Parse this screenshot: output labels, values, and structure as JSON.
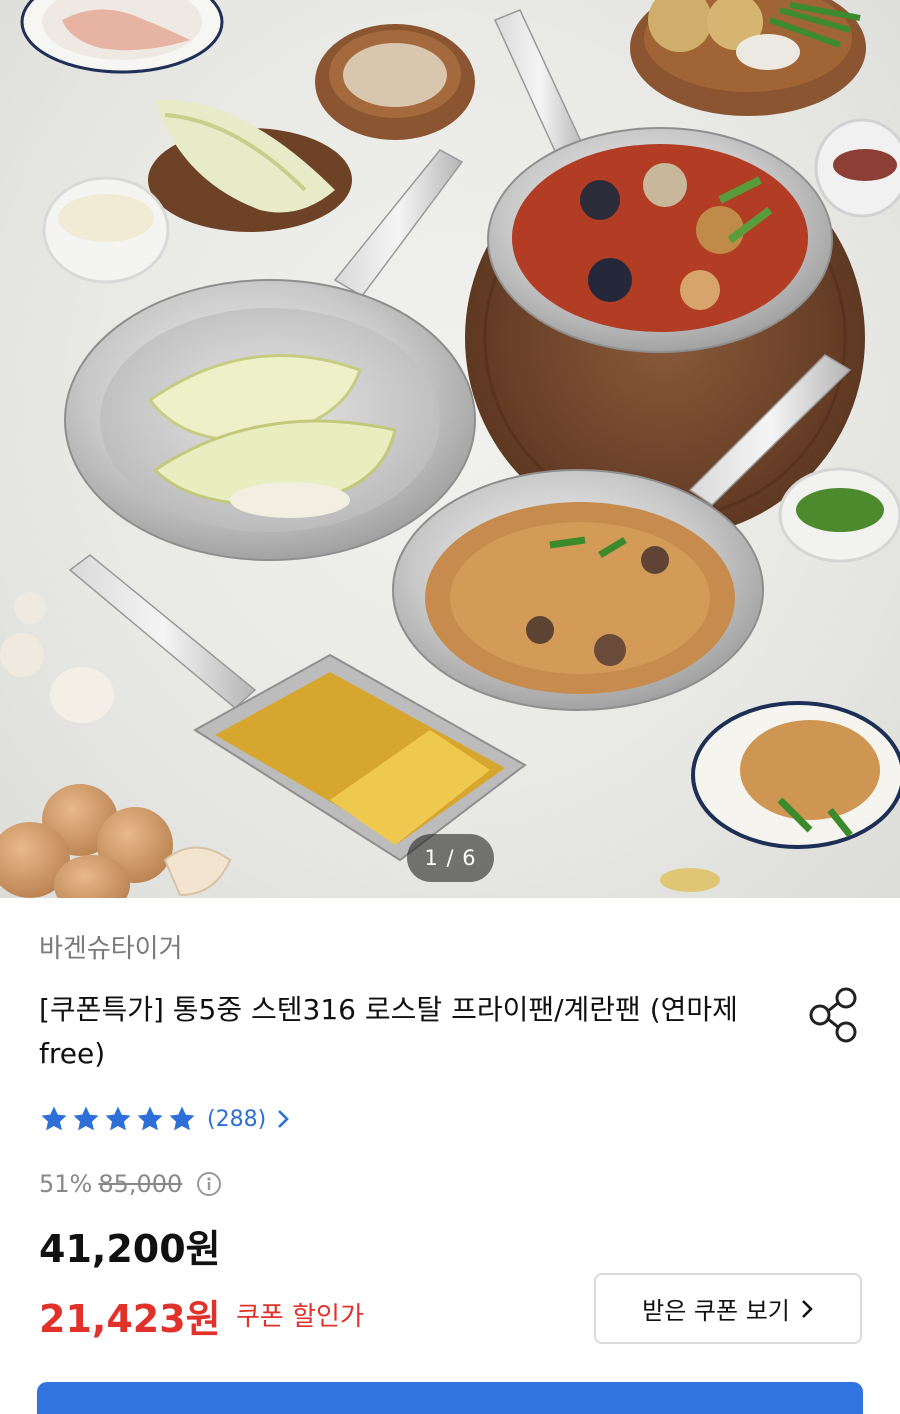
{
  "gallery": {
    "index_label": "1 / 6",
    "alt": "스테인리스 프라이팬, 웍, 계란말이팬 요리 연출 이미지"
  },
  "product": {
    "brand": "바겐슈타이거",
    "title": "[쿠폰특가] 통5중 스텐316 로스탈 프라이팬/계란팬 (연마제 free)",
    "rating": {
      "stars": 5,
      "review_count": "(288)"
    },
    "discount_rate": "51%",
    "original_price": "85,000",
    "price": "41,200원",
    "coupon_price": "21,423원",
    "coupon_label": "쿠폰 할인가",
    "coupon_button_label": "받은 쿠폰 보기"
  },
  "icons": {
    "share": "share-icon",
    "info": "info-icon",
    "star": "star-icon",
    "chevron": "chevron-right-icon"
  },
  "colors": {
    "accent_blue": "#2d6fd6",
    "cta_blue": "#3174e0",
    "sale_red": "#e0322b",
    "star_blue": "#2f6fd8"
  }
}
